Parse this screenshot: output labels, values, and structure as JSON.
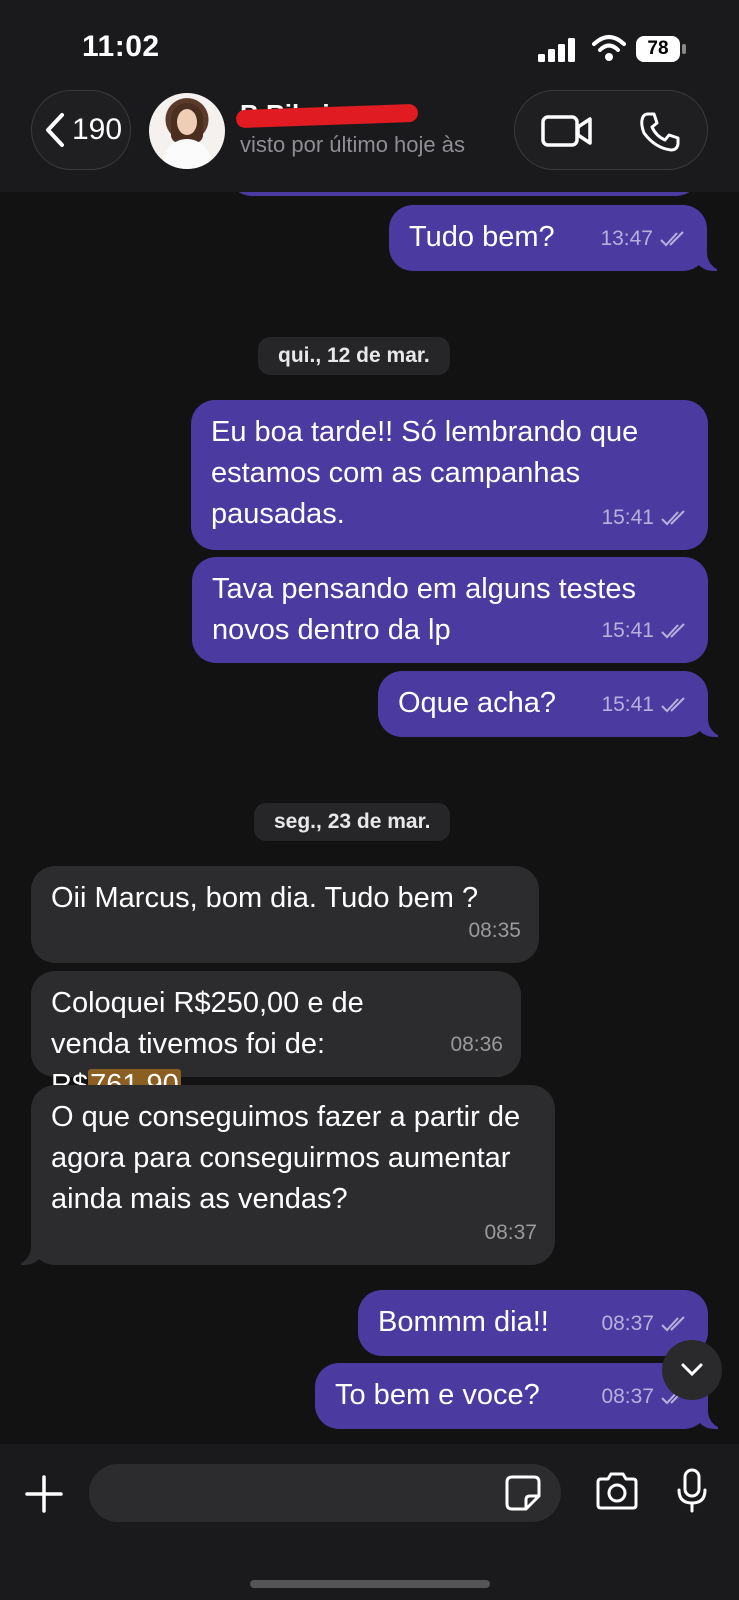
{
  "status_bar": {
    "time": "11:02",
    "battery": "78"
  },
  "header": {
    "back_count": "190",
    "contact_name": "B    Ribeiro",
    "last_seen": "visto por último hoje às"
  },
  "messages": [
    {
      "dir": "out",
      "text": "Tudo bem?",
      "time": "13:47"
    },
    {
      "date": "qui., 12 de mar."
    },
    {
      "dir": "out",
      "text": "Eu boa tarde!! Só lembrando que estamos com as campanhas pausadas.",
      "time": "15:41"
    },
    {
      "dir": "out",
      "text": "Tava pensando em alguns testes novos dentro da lp",
      "time": "15:41"
    },
    {
      "dir": "out",
      "text": "Oque acha?",
      "time": "15:41"
    },
    {
      "date": "seg., 23 de mar."
    },
    {
      "dir": "in",
      "text": "Oii Marcus, bom dia. Tudo bem ?",
      "time": "08:35"
    },
    {
      "dir": "in",
      "text_prefix": "Coloquei R$250,00 e de venda tivemos foi de: R$",
      "text_highlight": "761,90",
      "time": "08:36"
    },
    {
      "dir": "in",
      "text": "O que conseguimos fazer a partir de agora para conseguirmos aumentar ainda mais as vendas?",
      "time": "08:37"
    },
    {
      "dir": "out",
      "text": "Bommm dia!!",
      "time": "08:37"
    },
    {
      "dir": "out",
      "text": "To bem e  voce?",
      "time": "08:37"
    }
  ],
  "composer": {
    "placeholder": ""
  },
  "colors": {
    "outgoing": "#4b3aa0",
    "incoming": "#2c2c2e",
    "background": "#121212",
    "highlight": "#8b5e22"
  }
}
